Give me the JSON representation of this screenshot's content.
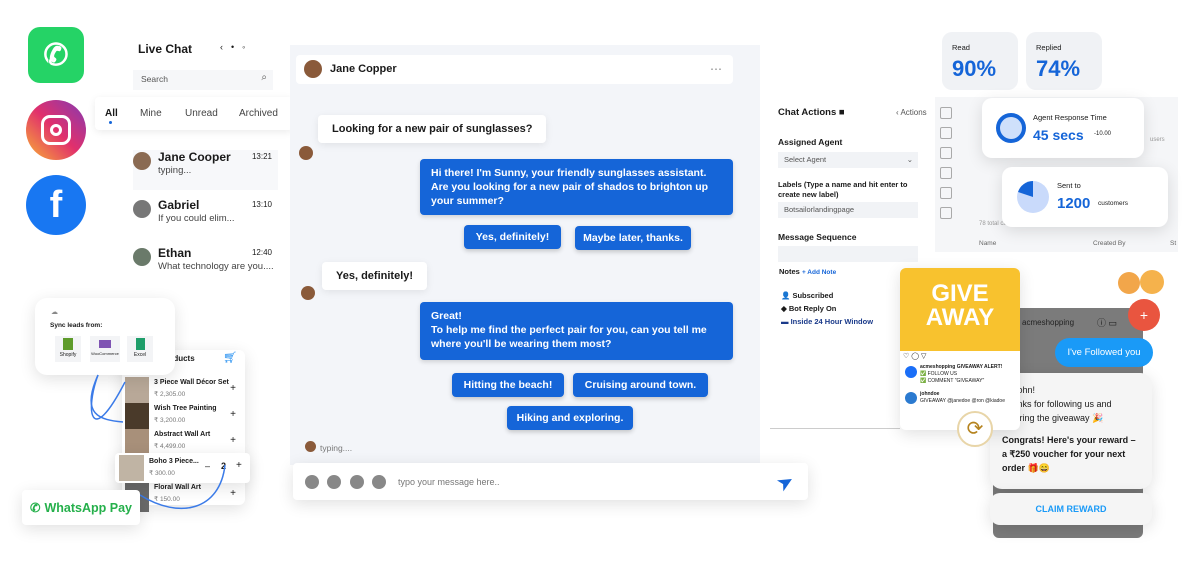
{
  "social": {
    "whatsapp": "whatsapp-icon",
    "instagram": "instagram-icon",
    "facebook": "facebook-icon"
  },
  "live_chat": {
    "title": "Live Chat",
    "search_placeholder": "Search",
    "tabs": [
      "All",
      "Mine",
      "Unread",
      "Archived"
    ],
    "conversations": [
      {
        "name": "Jane Cooper",
        "time": "13:21",
        "preview": "typing..."
      },
      {
        "name": "Gabriel",
        "time": "13:10",
        "preview": "If you could elim..."
      },
      {
        "name": "Ethan",
        "time": "12:40",
        "preview": "What technology are you...."
      }
    ]
  },
  "chat": {
    "contact": "Jane Copper",
    "more": "⋯",
    "messages": [
      {
        "from": "user",
        "text": "Looking for a new pair of sunglasses?"
      },
      {
        "from": "bot",
        "text": "Hi there! I'm Sunny, your friendly sunglasses assistant. Are you looking for a new pair of shados to brighton up your summer?"
      },
      {
        "from": "user",
        "text": "Yes, definitely!"
      },
      {
        "from": "bot",
        "text": "Great!\nTo help me find the perfect pair for you, can you tell me where you'll be wearing them most?"
      }
    ],
    "quick_replies_1": [
      "Yes, definitely!",
      "Maybe later, thanks."
    ],
    "quick_replies_2": [
      "Hitting the beach!",
      "Cruising around town.",
      "Hiking and exploring."
    ],
    "typing": "typing....",
    "input_placeholder": "typo your message here.."
  },
  "chat_actions": {
    "title": "Chat Actions",
    "back": "‹ Actions",
    "assigned_agent_label": "Assigned Agent",
    "agent_select": "Select Agent",
    "labels_label": "Labels (Type a name and hit enter to create new label)",
    "label_value": "Botsailorlandingpage",
    "sequence_label": "Message Sequence",
    "notes_label": "Notes",
    "add_note": "+ Add Note",
    "status": [
      "Subscribed",
      "Bot Reply On",
      "Inside 24 Hour Window"
    ]
  },
  "stats": {
    "read_label": "Read",
    "read_value": "90%",
    "replied_label": "Replied",
    "replied_value": "74%",
    "response_label": "Agent Response Time",
    "response_value": "45 secs",
    "response_delta": "-10.00",
    "sent_label": "Sent to",
    "sent_value": "1200",
    "sent_unit": "customers",
    "sent_fraction": 0.2
  },
  "dashboard_bg": {
    "total": "78 total ca",
    "col_name": "Name",
    "col_created": "Created By",
    "col_s": "St",
    "users": "users"
  },
  "sync": {
    "title": "Sync leads from:",
    "sources": [
      "Shopify",
      "WooCommerce",
      "Excel"
    ]
  },
  "products": {
    "title": "Products",
    "items": [
      {
        "name": "3 Piece Wall Décor Set",
        "price": "₹ 2,305.00"
      },
      {
        "name": "Wish Tree Painting",
        "price": "₹ 3,200.00"
      },
      {
        "name": "Abstract Wall Art",
        "price": "₹ 4,499.00"
      },
      {
        "name": "Floral Wall Art",
        "price": "₹ 150.00"
      }
    ],
    "cart_item": {
      "name": "Boho 3 Piece...",
      "price": "₹ 300.00",
      "qty": "2"
    }
  },
  "whatsapp_pay": "WhatsApp Pay",
  "instagram": {
    "giveaway_line1": "GIVE",
    "giveaway_line2": "AWAY",
    "post_user": "acmeshopping",
    "post_text": "GIVEAWAY ALERT!",
    "post_l2": "✅ FOLLOW US",
    "post_l3": "✅ COMMENT \"GIVEAWAY\"",
    "commenter": "johndoe",
    "comment": "GIVEAWAY @janedoe @ron @kiadoe",
    "account": "acmeshopping",
    "followed": "I've Followed you",
    "reply_l1": "Hi John!",
    "reply_l2": "Thanks for following us and entering the giveaway 🎉",
    "reply_l3": "Congrats! Here's your reward – a ₹250 voucher for your next order 🎁😄",
    "claim": "CLAIM REWARD"
  },
  "colors": {
    "primary": "#1565d8",
    "whatsapp": "#25d366",
    "ig_blue": "#1a9af7"
  }
}
